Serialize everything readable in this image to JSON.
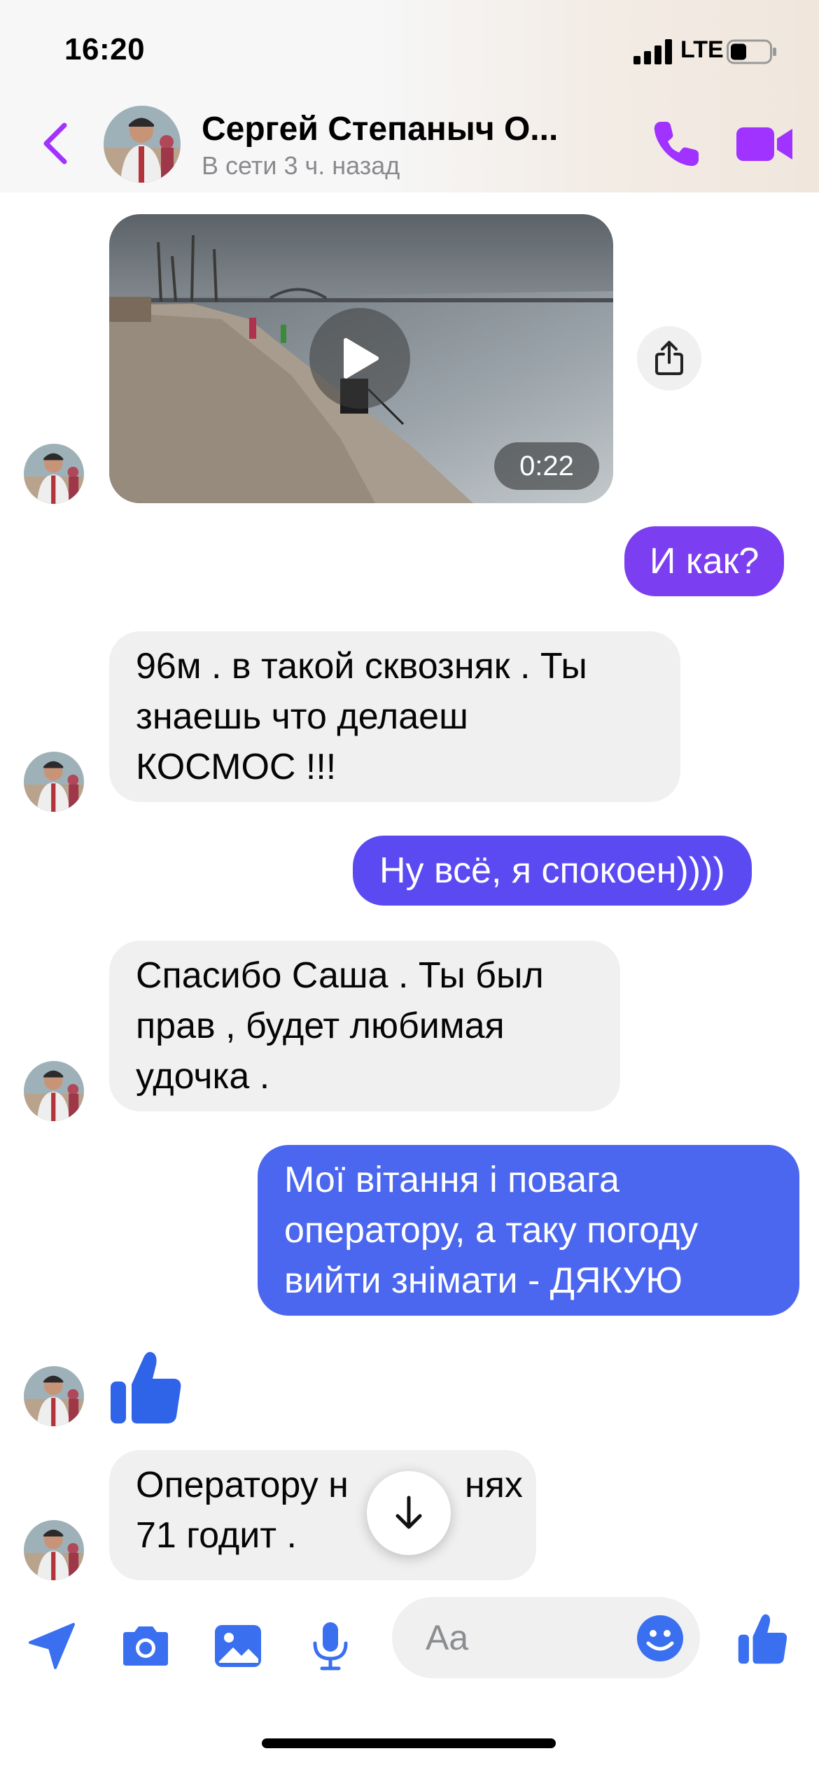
{
  "status_bar": {
    "time": "16:20",
    "network": "LTE"
  },
  "header": {
    "contact_name": "Сергей Степаныч О...",
    "presence": "В сети 3 ч. назад"
  },
  "video": {
    "duration": "0:22"
  },
  "messages": [
    {
      "from": "them",
      "type": "video"
    },
    {
      "from": "me",
      "text": "И как?"
    },
    {
      "from": "them",
      "lines": [
        "96м . в такой сквозняк . Ты",
        "знаешь что делаеш",
        "КОСМОС !!!"
      ]
    },
    {
      "from": "me",
      "text": "Ну всё, я спокоен))))"
    },
    {
      "from": "them",
      "lines": [
        "Спасибо Саша . Ты был",
        "прав , будет любимая",
        "удочка ."
      ]
    },
    {
      "from": "me",
      "lines": [
        "Мої вітання і повага",
        "оператору, а таку погоду",
        "вийти знімати - ДЯКУЮ"
      ]
    },
    {
      "from": "them",
      "type": "like"
    },
    {
      "from": "them",
      "lines": [
        "Оператору н",
        "71 годит ."
      ],
      "partial_end": "нях"
    }
  ],
  "composer": {
    "placeholder": "Aa"
  },
  "colors": {
    "accent_purple": "#a033ff",
    "bubble_purple": "#7b3ef0",
    "bubble_indigo": "#5b4af2",
    "bubble_blue": "#4b67ef",
    "toolbar_blue": "#3a6ff0",
    "incoming_bg": "#f0f0f0"
  },
  "icons": [
    "back-chevron-icon",
    "phone-icon",
    "video-camera-icon",
    "play-icon",
    "share-icon",
    "thumbs-up-icon",
    "arrow-down-icon",
    "location-arrow-icon",
    "camera-icon",
    "gallery-icon",
    "microphone-icon",
    "emoji-icon"
  ]
}
